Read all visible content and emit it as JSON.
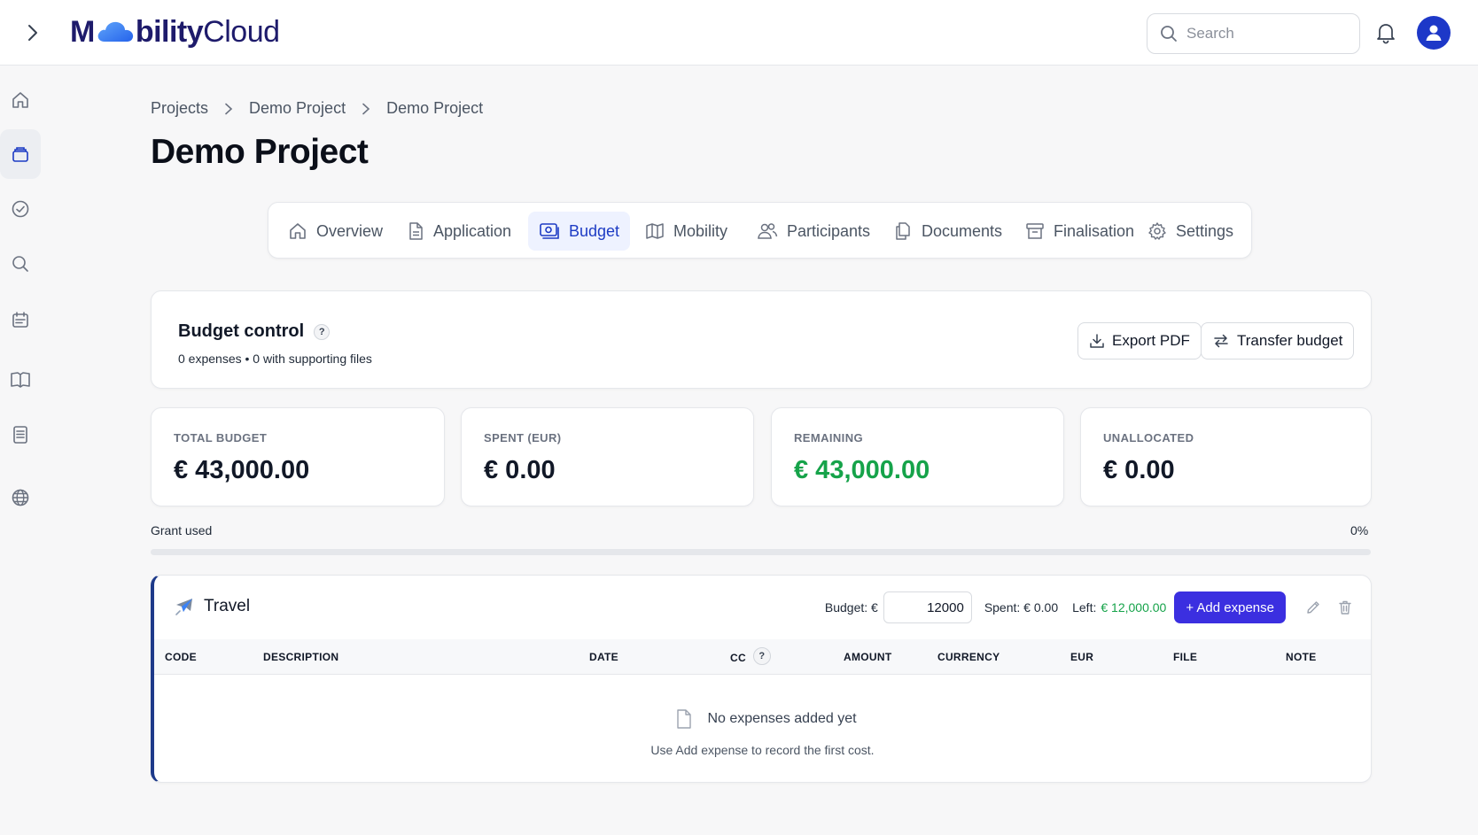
{
  "app": {
    "logo_bold_left": "M",
    "logo_bold_right": "bility",
    "logo_light": "Cloud",
    "search_placeholder": "Search"
  },
  "sidebar": {
    "items": [
      {
        "icon": "home-icon"
      },
      {
        "icon": "projects-icon",
        "active": true
      },
      {
        "icon": "check-circle-icon"
      },
      {
        "icon": "search-icon"
      },
      {
        "icon": "calendar-icon"
      },
      {
        "icon": "book-icon"
      },
      {
        "icon": "document-icon"
      },
      {
        "icon": "globe-icon"
      }
    ]
  },
  "breadcrumb": [
    "Projects",
    "Demo Project",
    "Demo Project"
  ],
  "page_title": "Demo Project",
  "tabs": [
    {
      "label": "Overview",
      "icon": "home-icon"
    },
    {
      "label": "Application",
      "icon": "document-icon"
    },
    {
      "label": "Budget",
      "icon": "money-icon",
      "active": true
    },
    {
      "label": "Mobility",
      "icon": "map-icon"
    },
    {
      "label": "Participants",
      "icon": "users-icon"
    },
    {
      "label": "Documents",
      "icon": "documents-icon"
    },
    {
      "label": "Finalisation",
      "icon": "archive-icon"
    },
    {
      "label": "Settings",
      "icon": "gear-icon"
    }
  ],
  "budget_control": {
    "title": "Budget control",
    "help": "?",
    "subtitle": "0 expenses • 0 with supporting files",
    "export_label": "Export PDF",
    "transfer_label": "Transfer budget"
  },
  "stats": [
    {
      "label": "TOTAL BUDGET",
      "value": "€ 43,000.00",
      "color": "#111827"
    },
    {
      "label": "SPENT (EUR)",
      "value": "€ 0.00",
      "color": "#111827"
    },
    {
      "label": "REMAINING",
      "value": "€ 43,000.00",
      "color": "#16a34a"
    },
    {
      "label": "UNALLOCATED",
      "value": "€ 0.00",
      "color": "#111827"
    }
  ],
  "grant": {
    "label": "Grant used",
    "percent_text": "0%",
    "percent": 0
  },
  "category": {
    "name": "Travel",
    "icon": "airplane-icon",
    "budget_label": "Budget: €",
    "budget_value": "12000",
    "spent_label": "Spent: € 0.00",
    "left_label": "Left:",
    "left_value": "€ 12,000.00",
    "add_expense_label": "+ Add expense",
    "columns": [
      "CODE",
      "DESCRIPTION",
      "DATE",
      "CC",
      "AMOUNT",
      "CURRENCY",
      "EUR",
      "FILE",
      "NOTE"
    ],
    "cc_help": "?",
    "empty_title": "No expenses added yet",
    "empty_sub": "Use Add expense to record the first cost."
  },
  "colors": {
    "accent": "#1d3bc4",
    "primary_button": "#3b2fe0",
    "positive": "#16a34a",
    "category_border": "#1e3a8a"
  }
}
